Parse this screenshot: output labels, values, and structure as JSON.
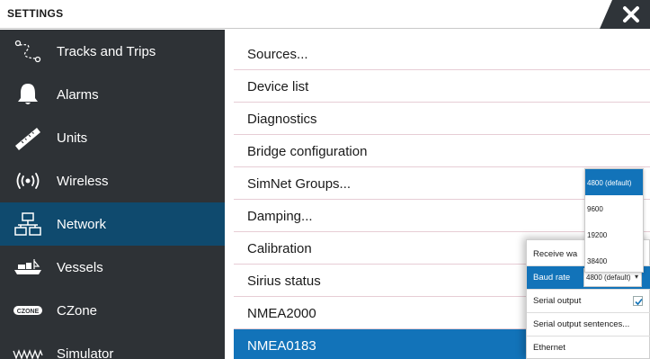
{
  "window": {
    "title": "SETTINGS",
    "close_icon": "close-icon"
  },
  "sidebar": {
    "items": [
      {
        "label": "Tracks and Trips",
        "icon": "tracks-trips-icon"
      },
      {
        "label": "Alarms",
        "icon": "bell-icon"
      },
      {
        "label": "Units",
        "icon": "ruler-icon"
      },
      {
        "label": "Wireless",
        "icon": "wireless-icon"
      },
      {
        "label": "Network",
        "icon": "network-icon",
        "active": true
      },
      {
        "label": "Vessels",
        "icon": "vessels-icon"
      },
      {
        "label": "CZone",
        "icon": "czone-logo-icon",
        "logo_text": "CZONE"
      },
      {
        "label": "Simulator",
        "icon": "simulator-icon"
      }
    ]
  },
  "menu": {
    "items": [
      {
        "label": "Sources..."
      },
      {
        "label": "Device list"
      },
      {
        "label": "Diagnostics"
      },
      {
        "label": "Bridge configuration"
      },
      {
        "label": "SimNet Groups..."
      },
      {
        "label": "Damping..."
      },
      {
        "label": "Calibration"
      },
      {
        "label": "Sirius status"
      },
      {
        "label": "NMEA2000"
      },
      {
        "label": "NMEA0183",
        "selected": true
      }
    ]
  },
  "nmea0183_popup": {
    "receive_label": "Receive wa",
    "baud_label": "Baud rate",
    "baud_value": "4800 (default)",
    "serial_output_label": "Serial output",
    "serial_output_checked": true,
    "serial_output_sentences_label": "Serial output sentences...",
    "ethernet_label": "Ethernet"
  },
  "baud_dropdown": {
    "options": [
      "4800 (default)",
      "9600",
      "19200",
      "38400"
    ],
    "selected": "4800 (default)"
  },
  "colors": {
    "sidebar_bg": "#2e3236",
    "sidebar_active": "#0f4a6e",
    "accent_blue": "#1273b9",
    "separator": "#e7cdd5"
  }
}
